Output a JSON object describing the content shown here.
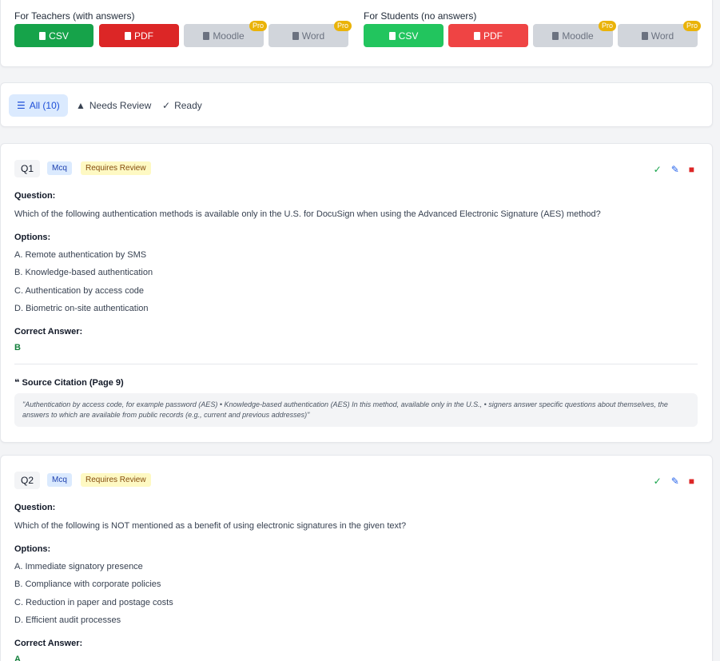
{
  "export": {
    "teachers_title": "For Teachers (with answers)",
    "students_title": "For Students (no answers)",
    "csv": "CSV",
    "pdf": "PDF",
    "moodle": "Moodle",
    "word": "Word",
    "pro": "Pro"
  },
  "filters": {
    "all": "All (10)",
    "needs_review": "Needs Review",
    "ready": "Ready"
  },
  "questions": [
    {
      "num": "Q1",
      "type": "Mcq",
      "status": "Requires Review",
      "question_label": "Question:",
      "question": "Which of the following authentication methods is available only in the U.S. for DocuSign when using the Advanced Electronic Signature (AES) method?",
      "options_label": "Options:",
      "options": [
        "A. Remote authentication by SMS",
        "B. Knowledge-based authentication",
        "C. Authentication by access code",
        "D. Biometric on-site authentication"
      ],
      "answer_label": "Correct Answer:",
      "answer": "B",
      "citation_title": "Source Citation (Page 9)",
      "citation": "\"Authentication by access code, for example password (AES) • Knowledge-based authentication (AES) In this method, available only in the U.S., • signers answer specific questions about themselves, the answers to which are available from public records (e.g., current and previous addresses)\""
    },
    {
      "num": "Q2",
      "type": "Mcq",
      "status": "Requires Review",
      "question_label": "Question:",
      "question": "Which of the following is NOT mentioned as a benefit of using electronic signatures in the given text?",
      "options_label": "Options:",
      "options": [
        "A. Immediate signatory presence",
        "B. Compliance with corporate policies",
        "C. Reduction in paper and postage costs",
        "D. Efficient audit processes"
      ],
      "answer_label": "Correct Answer:",
      "answer": "A"
    }
  ]
}
